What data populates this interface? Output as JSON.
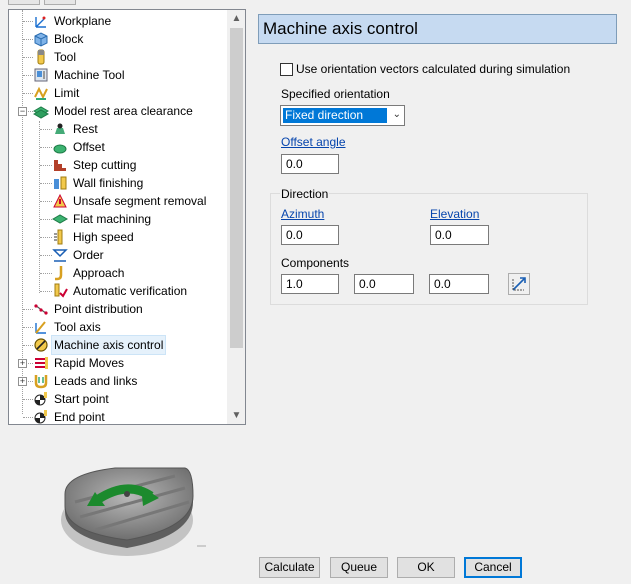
{
  "tree": {
    "items": [
      {
        "label": "Workplane",
        "icon": "workplane-icon"
      },
      {
        "label": "Block",
        "icon": "block-icon"
      },
      {
        "label": "Tool",
        "icon": "tool-icon"
      },
      {
        "label": "Machine Tool",
        "icon": "machine-tool-icon"
      },
      {
        "label": "Limit",
        "icon": "limit-icon"
      },
      {
        "label": "Model rest area clearance",
        "icon": "model-rest-area-icon"
      },
      {
        "label": "Rest",
        "icon": "rest-icon"
      },
      {
        "label": "Offset",
        "icon": "offset-icon"
      },
      {
        "label": "Step cutting",
        "icon": "step-cutting-icon"
      },
      {
        "label": "Wall finishing",
        "icon": "wall-finishing-icon"
      },
      {
        "label": "Unsafe segment removal",
        "icon": "unsafe-segment-icon"
      },
      {
        "label": "Flat machining",
        "icon": "flat-machining-icon"
      },
      {
        "label": "High speed",
        "icon": "high-speed-icon"
      },
      {
        "label": "Order",
        "icon": "order-icon"
      },
      {
        "label": "Approach",
        "icon": "approach-icon"
      },
      {
        "label": "Automatic verification",
        "icon": "automatic-verification-icon"
      },
      {
        "label": "Point distribution",
        "icon": "point-distribution-icon"
      },
      {
        "label": "Tool axis",
        "icon": "tool-axis-icon"
      },
      {
        "label": "Machine axis control",
        "icon": "machine-axis-control-icon"
      },
      {
        "label": "Rapid Moves",
        "icon": "rapid-moves-icon"
      },
      {
        "label": "Leads and links",
        "icon": "leads-links-icon"
      },
      {
        "label": "Start point",
        "icon": "start-point-icon"
      },
      {
        "label": "End point",
        "icon": "end-point-icon"
      }
    ],
    "selected": "Machine axis control"
  },
  "panel": {
    "title": "Machine axis control",
    "use_orientation_label": "Use orientation vectors calculated during simulation",
    "use_orientation_checked": false,
    "specified_orientation_label": "Specified orientation",
    "specified_orientation_value": "Fixed direction",
    "offset_angle_label": "Offset angle",
    "offset_angle_value": "0.0",
    "direction_label": "Direction",
    "azimuth_label": "Azimuth",
    "azimuth_value": "0.0",
    "elevation_label": "Elevation",
    "elevation_value": "0.0",
    "components_label": "Components",
    "component_i": "1.0",
    "component_j": "0.0",
    "component_k": "0.0"
  },
  "buttons": {
    "calculate": "Calculate",
    "queue": "Queue",
    "ok": "OK",
    "cancel": "Cancel"
  },
  "colors": {
    "title_bg": "#c6daf1",
    "selection_bg": "#0078d7",
    "link": "#0645ad"
  }
}
